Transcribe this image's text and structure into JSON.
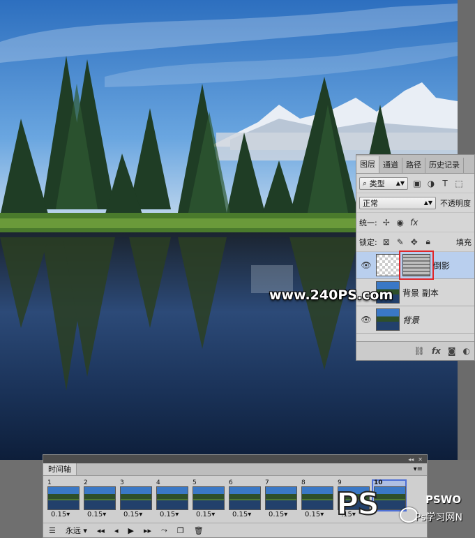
{
  "layers_panel": {
    "tabs": [
      "图层",
      "通道",
      "路径",
      "历史记录"
    ],
    "filter_kind": "类型",
    "blend_mode": "正常",
    "opacity_label": "不透明度",
    "unify_label": "统一:",
    "lock_label": "锁定:",
    "fill_label": "填充",
    "layers": [
      {
        "name": "倒影",
        "selected": true,
        "visible": true
      },
      {
        "name": "背景 副本",
        "selected": false,
        "visible": false
      },
      {
        "name": "背景",
        "selected": false,
        "visible": true
      }
    ]
  },
  "timeline": {
    "tab": "时间轴",
    "frames": [
      {
        "number": "1",
        "duration": "0.15"
      },
      {
        "number": "2",
        "duration": "0.15"
      },
      {
        "number": "3",
        "duration": "0.15"
      },
      {
        "number": "4",
        "duration": "0.15"
      },
      {
        "number": "5",
        "duration": "0.15"
      },
      {
        "number": "6",
        "duration": "0.15"
      },
      {
        "number": "7",
        "duration": "0.15"
      },
      {
        "number": "8",
        "duration": "0.15"
      },
      {
        "number": "9",
        "duration": ".15"
      },
      {
        "number": "10",
        "duration": ""
      }
    ],
    "selected_frame": "10",
    "loop": "永远"
  },
  "watermark": {
    "url": "www.240PS.com",
    "logo": "PS",
    "brand_top": "PSWO",
    "brand_bottom": "Ps学习网N"
  },
  "colors": {
    "selection": "#b9cfee",
    "highlight_box": "#e0262a"
  }
}
